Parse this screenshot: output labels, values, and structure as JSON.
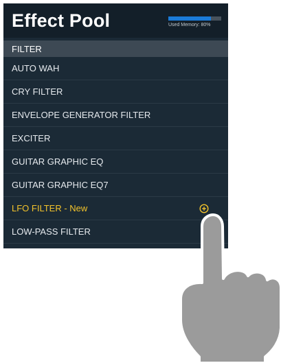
{
  "header": {
    "title": "Effect Pool",
    "memory_label": "Used Memory: 80%",
    "memory_fraction": 0.8
  },
  "section": {
    "label": "FILTER"
  },
  "items": [
    {
      "label": "AUTO WAH"
    },
    {
      "label": "CRY FILTER"
    },
    {
      "label": "ENVELOPE GENERATOR FILTER"
    },
    {
      "label": "EXCITER"
    },
    {
      "label": "GUITAR GRAPHIC EQ"
    },
    {
      "label": "GUITAR GRAPHIC EQ7"
    },
    {
      "label": "LFO FILTER - New",
      "highlight": true,
      "icon": "add-circle-icon"
    },
    {
      "label": "LOW-PASS FILTER"
    }
  ],
  "colors": {
    "accent_new": "#f3c32b",
    "memory_bar": "#1b7bd8",
    "panel_bg": "#1b2a36"
  }
}
